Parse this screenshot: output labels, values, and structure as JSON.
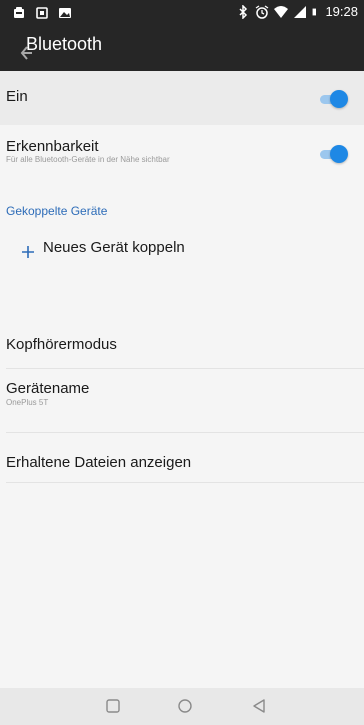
{
  "status_bar": {
    "time": "19:28",
    "left_icons": [
      "notification-icon",
      "notification-icon",
      "image-icon"
    ],
    "right_icons": [
      "bluetooth-icon",
      "alarm-icon",
      "wifi-icon",
      "signal-icon",
      "battery-icon"
    ]
  },
  "app_bar": {
    "title": "Bluetooth",
    "back_icon": "back-arrow-icon"
  },
  "settings": {
    "ein": {
      "title": "Ein",
      "on": true
    },
    "erkennbarkeit": {
      "title": "Erkennbarkeit",
      "subtitle": "Für alle Bluetooth-Geräte in der Nähe sichtbar",
      "on": true
    },
    "section_paired": "Gekoppelte Geräte",
    "pair_new": {
      "label": "Neues Gerät koppeln",
      "icon": "plus-icon"
    },
    "headphone_mode": {
      "title": "Kopfhörermodus"
    },
    "device_name": {
      "title": "Gerätename",
      "subtitle": "OnePlus 5T"
    },
    "received_files": {
      "title": "Erhaltene Dateien anzeigen"
    }
  },
  "nav_bar": {
    "buttons": [
      "recents-square-icon",
      "home-circle-icon",
      "back-triangle-icon"
    ]
  },
  "colors": {
    "top_bar": "#262626",
    "accent": "#1e88e5",
    "section_header": "#2d6cb8",
    "background": "#f5f5f5"
  }
}
